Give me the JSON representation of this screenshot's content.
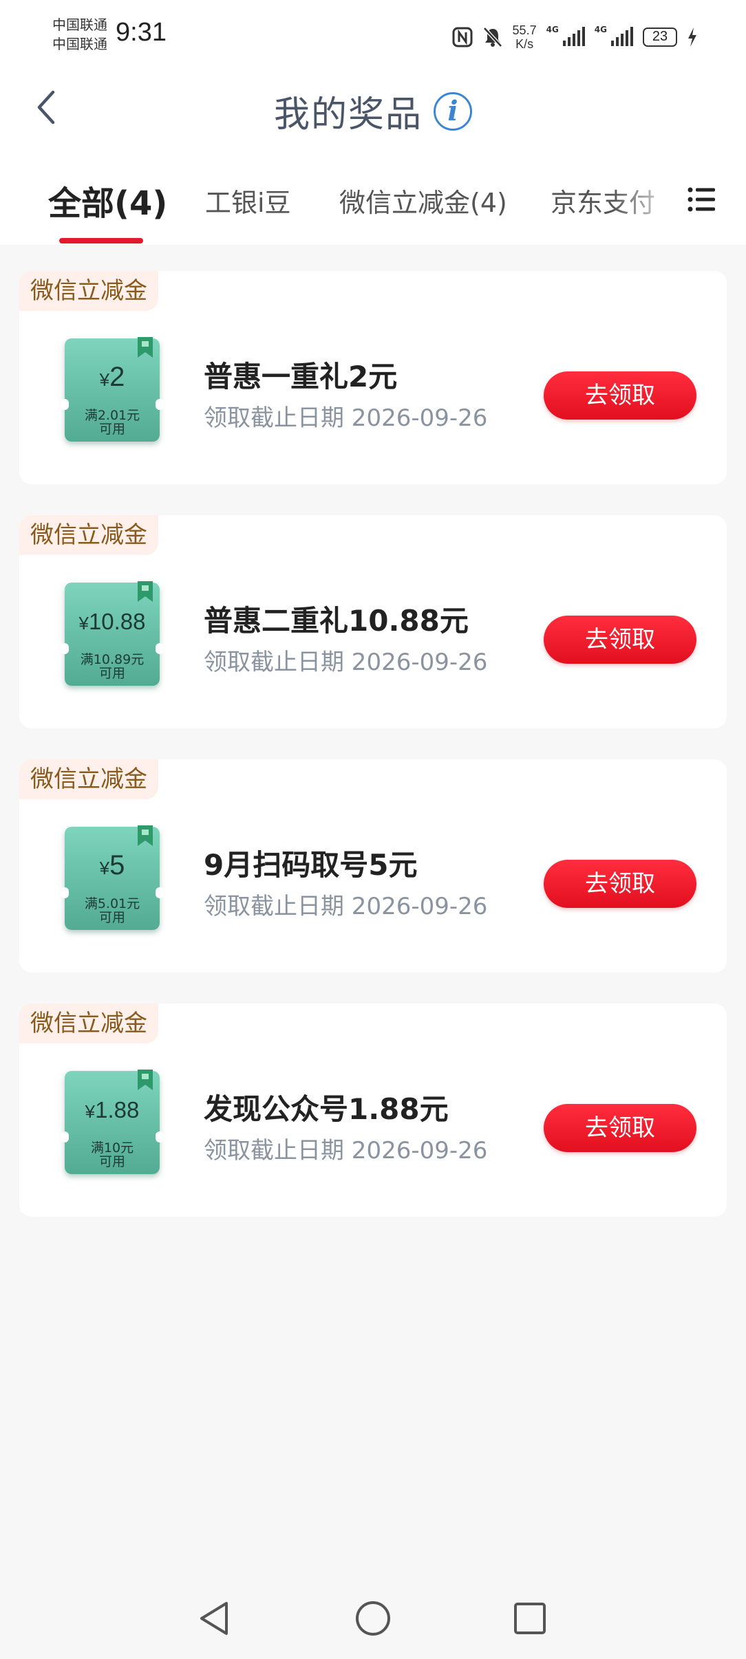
{
  "status_bar": {
    "carrier_1": "中国联通",
    "carrier_2": "中国联通",
    "time": "9:31",
    "net_speed_value": "55.7",
    "net_speed_unit": "K/s",
    "signal_1_label": "4G",
    "signal_2_label": "4G",
    "battery": "23"
  },
  "header": {
    "title": "我的奖品"
  },
  "tabs": [
    {
      "label": "全部(4)",
      "active": true
    },
    {
      "label": "工银i豆",
      "active": false
    },
    {
      "label": "微信立减金(4)",
      "active": false
    },
    {
      "label": "京东支付",
      "active": false
    }
  ],
  "prizes": [
    {
      "category": "微信立减金",
      "coupon_currency": "¥",
      "coupon_amount": "2",
      "coupon_condition": "满2.01元",
      "coupon_usable": "可用",
      "name": "普惠一重礼2元",
      "deadline": "领取截止日期 2026-09-26",
      "button": "去领取"
    },
    {
      "category": "微信立减金",
      "coupon_currency": "¥",
      "coupon_amount": "10.88",
      "coupon_condition": "满10.89元",
      "coupon_usable": "可用",
      "name": "普惠二重礼10.88元",
      "deadline": "领取截止日期 2026-09-26",
      "button": "去领取"
    },
    {
      "category": "微信立减金",
      "coupon_currency": "¥",
      "coupon_amount": "5",
      "coupon_condition": "满5.01元",
      "coupon_usable": "可用",
      "name": "9月扫码取号5元",
      "deadline": "领取截止日期 2026-09-26",
      "button": "去领取"
    },
    {
      "category": "微信立减金",
      "coupon_currency": "¥",
      "coupon_amount": "1.88",
      "coupon_condition": "满10元",
      "coupon_usable": "可用",
      "name": "发现公众号1.88元",
      "deadline": "领取截止日期 2026-09-26",
      "button": "去领取"
    }
  ],
  "colors": {
    "accent_red": "#e21b2c",
    "coupon_green": "#52ab92",
    "tag_text": "#8a5a1c",
    "info_blue": "#3a86d4"
  }
}
